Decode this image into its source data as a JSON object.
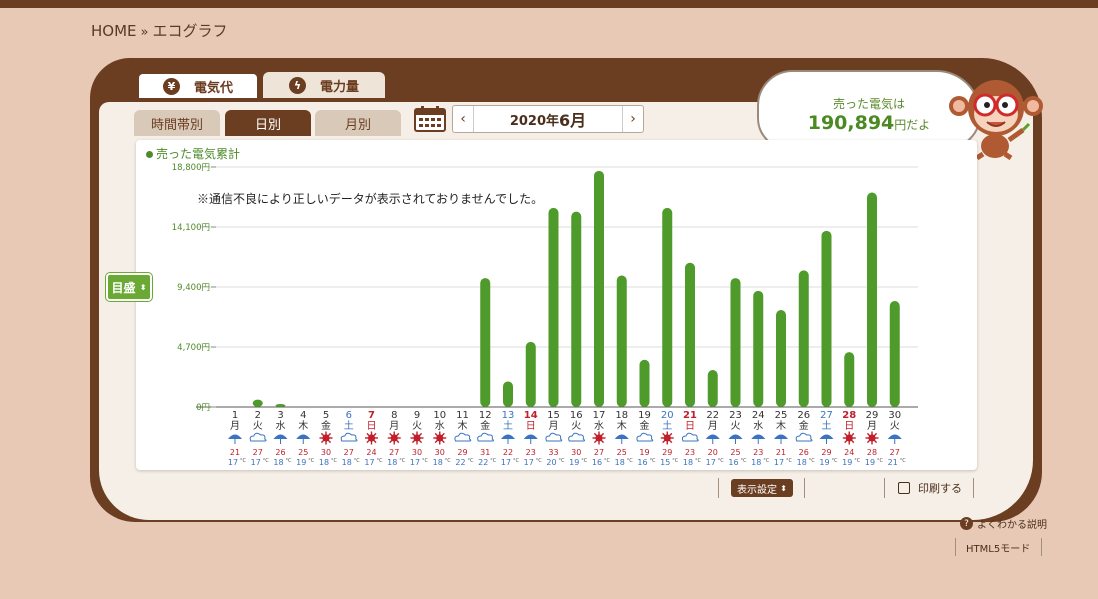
{
  "breadcrumb": {
    "home": "HOME",
    "sep": "»",
    "current": "エコグラフ"
  },
  "main_tabs": [
    {
      "label": "電気代",
      "icon": "yen-icon",
      "glyph": "¥",
      "active": true
    },
    {
      "label": "電力量",
      "icon": "lightning-icon",
      "glyph": "ϟ",
      "active": false
    }
  ],
  "sub_tabs": [
    {
      "label": "時間帯別",
      "active": false
    },
    {
      "label": "日別",
      "active": true
    },
    {
      "label": "月別",
      "active": false
    }
  ],
  "month_nav": {
    "prev": "‹",
    "next": "›",
    "year_label": "2020年",
    "month_label": "6月"
  },
  "summary": {
    "line1": "売った電気は",
    "amount": "190,894",
    "suffix": "円だよ"
  },
  "legend_label": "売った電気累計",
  "notice": "※通信不良により正しいデータが表示されておりませんでした。",
  "scale_button": "目盛",
  "display_settings": "表示設定",
  "print_label": "印刷する",
  "help_label": "よくわかる説明",
  "html5_label": "HTML5モード",
  "colors": {
    "bar": "#4e9a2a",
    "brown": "#6b3e22",
    "sat": "#3a73c0",
    "sun": "#c0202a",
    "high": "#c0202a",
    "low": "#3a73c0"
  },
  "chart_data": {
    "type": "bar",
    "y_ticks": [
      "0円",
      "4,700円",
      "9,400円",
      "14,100円",
      "18,800円"
    ],
    "ylim": [
      0,
      18800
    ],
    "days": [
      "1",
      "2",
      "3",
      "4",
      "5",
      "6",
      "7",
      "8",
      "9",
      "10",
      "11",
      "12",
      "13",
      "14",
      "15",
      "16",
      "17",
      "18",
      "19",
      "20",
      "21",
      "22",
      "23",
      "24",
      "25",
      "26",
      "27",
      "28",
      "29",
      "30"
    ],
    "weekdays": [
      "月",
      "火",
      "水",
      "木",
      "金",
      "土",
      "日",
      "月",
      "火",
      "水",
      "木",
      "金",
      "土",
      "日",
      "月",
      "火",
      "水",
      "木",
      "金",
      "土",
      "日",
      "月",
      "火",
      "水",
      "木",
      "金",
      "土",
      "日",
      "月",
      "火"
    ],
    "values": [
      0,
      580,
      230,
      0,
      0,
      0,
      0,
      0,
      0,
      0,
      0,
      10100,
      2000,
      5100,
      15600,
      15300,
      18500,
      10300,
      3700,
      15600,
      11300,
      2900,
      10100,
      9100,
      7600,
      10700,
      13800,
      4300,
      16800,
      8300
    ],
    "weather": [
      "rain",
      "cloud",
      "rain",
      "rain",
      "sun",
      "cloud",
      "sun",
      "sun",
      "sun",
      "sun",
      "cloud",
      "cloud",
      "rain",
      "rain",
      "cloud",
      "cloud",
      "sun",
      "rain",
      "cloud",
      "sun",
      "cloud",
      "rain",
      "rain",
      "rain",
      "rain",
      "cloud",
      "rain",
      "sun",
      "sun",
      "rain"
    ],
    "temp_high": [
      "21",
      "27",
      "26",
      "25",
      "30",
      "27",
      "24",
      "27",
      "30",
      "30",
      "29",
      "31",
      "22",
      "23",
      "33",
      "30",
      "27",
      "25",
      "19",
      "29",
      "23",
      "20",
      "25",
      "23",
      "21",
      "26",
      "29",
      "24",
      "28",
      "27"
    ],
    "temp_low": [
      "17",
      "17",
      "18",
      "19",
      "18",
      "18",
      "17",
      "18",
      "17",
      "18",
      "22",
      "22",
      "17",
      "17",
      "20",
      "19",
      "16",
      "18",
      "16",
      "15",
      "18",
      "17",
      "16",
      "18",
      "17",
      "18",
      "19",
      "19",
      "19",
      "21"
    ],
    "temp_unit": "°C"
  }
}
